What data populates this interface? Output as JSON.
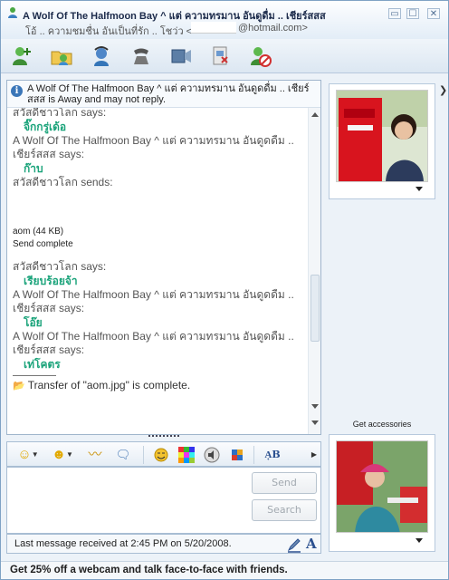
{
  "window": {
    "title": "A Wolf Of The Halfmoon Bay ^ แต่ ความทรมาน อันดูดื่ม .. เชียร์สสส",
    "subtitle": "โอ้ .. ความชมชื่น อันเป็นที่รัก .. โชว่ว <",
    "email": "@hotmail.com>",
    "controls": {
      "minimize": "▭",
      "maximize": "☐",
      "close": "✕"
    }
  },
  "toolbar": {
    "icons": [
      "add-contact-icon",
      "share-folder-icon",
      "voice-call-icon",
      "phone-icon",
      "video-icon",
      "remote-assistance-icon",
      "block-icon"
    ]
  },
  "away_banner": {
    "icon": "i",
    "text": "A Wolf Of The Halfmoon Bay ^ แต่ ความทรมาน อันดูดดื่ม .. เชียร์สสส is Away and may not reply."
  },
  "conversation": [
    {
      "type": "says",
      "text": "สวัสดีชาวโลก says:"
    },
    {
      "type": "msg",
      "text": "จิ๊กกรู่เด้อ"
    },
    {
      "type": "says",
      "text": "A Wolf Of The Halfmoon Bay ^ แต่ ความทรมาน อันดูดดื่ม .."
    },
    {
      "type": "says",
      "text": "เชียร์สสส says:"
    },
    {
      "type": "msg",
      "text": "ก๊าบ"
    },
    {
      "type": "says",
      "text": "สวัสดีชาวโลก sends:"
    },
    {
      "type": "spacer"
    },
    {
      "type": "plain",
      "text": "aom (44 KB)"
    },
    {
      "type": "plain",
      "text": "Send complete"
    },
    {
      "type": "spacer_small"
    },
    {
      "type": "says",
      "text": "สวัสดีชาวโลก says:"
    },
    {
      "type": "msg",
      "text": "เรียบร้อยจ้า"
    },
    {
      "type": "says",
      "text": "A Wolf Of The Halfmoon Bay ^ แต่ ความทรมาน อันดูดดื่ม .."
    },
    {
      "type": "says",
      "text": "เชียร์สสส says:"
    },
    {
      "type": "msg",
      "text": "โอ๊ย"
    },
    {
      "type": "says",
      "text": "A Wolf Of The Halfmoon Bay ^ แต่ ความทรมาน อันดูดดื่ม .."
    },
    {
      "type": "says",
      "text": "เชียร์สสส says:"
    },
    {
      "type": "msg",
      "text": "เท่โคตร"
    },
    {
      "type": "rule"
    },
    {
      "type": "transfer",
      "text": "Transfer of \"aom.jpg\" is complete."
    }
  ],
  "format_bar": {
    "emoticon": "☺",
    "wink": "☻",
    "nudge": "〰",
    "voice_clip": "🗨",
    "font_label": "A͎B"
  },
  "buttons": {
    "send": "Send",
    "search": "Search"
  },
  "status": {
    "last_message": "Last message received at 2:45 PM on 5/20/2008."
  },
  "side": {
    "get_accessories": "Get accessories",
    "collapse_arrow": "❯"
  },
  "ad": {
    "text": "Get 25% off a webcam and talk face-to-face with friends."
  },
  "colors": {
    "message_green": "#1AA37A",
    "accent_blue": "#2A4F8F",
    "frame": "#7FA2C4"
  }
}
